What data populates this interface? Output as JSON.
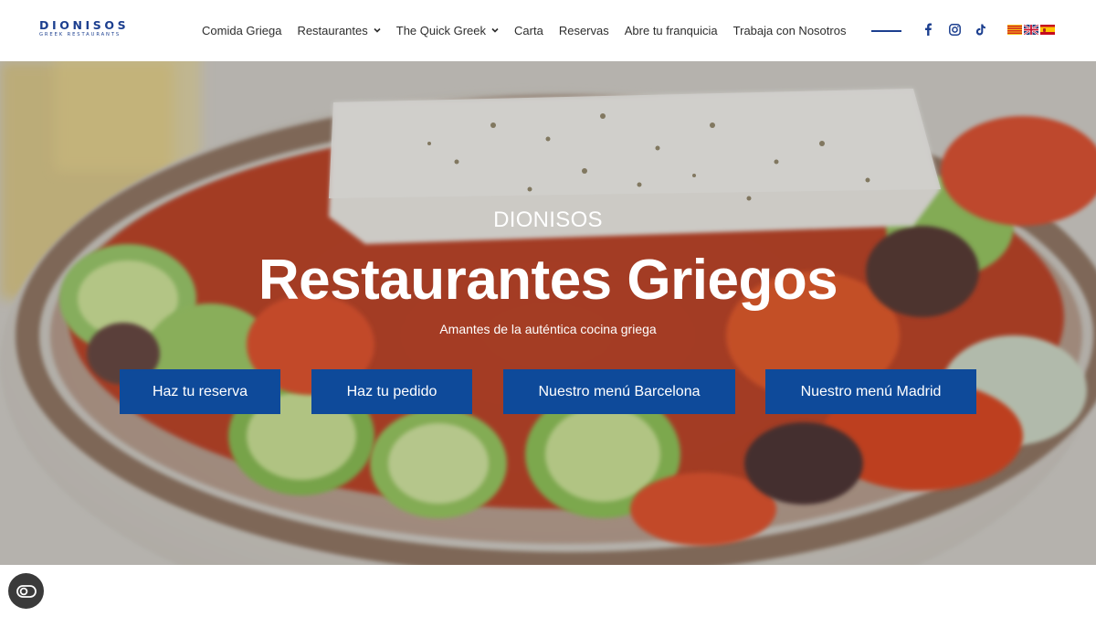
{
  "brand": {
    "name": "DIONISOS",
    "tagline": "GREEK RESTAURANTS",
    "color": "#1c3f8f"
  },
  "nav": {
    "items": [
      {
        "label": "Comida Griega",
        "has_dropdown": false
      },
      {
        "label": "Restaurantes",
        "has_dropdown": true
      },
      {
        "label": "The Quick Greek",
        "has_dropdown": true
      },
      {
        "label": "Carta",
        "has_dropdown": false
      },
      {
        "label": "Reservas",
        "has_dropdown": false
      },
      {
        "label": "Abre tu franquicia",
        "has_dropdown": false
      },
      {
        "label": "Trabaja con Nosotros",
        "has_dropdown": false
      }
    ]
  },
  "social": [
    "facebook-icon",
    "instagram-icon",
    "tiktok-icon"
  ],
  "languages": [
    "catalan",
    "english",
    "spanish"
  ],
  "hero": {
    "eyebrow": "DIONISOS",
    "title": "Restaurantes Griegos",
    "subtitle": "Amantes de la auténtica cocina griega",
    "buttons": [
      {
        "label": "Haz tu reserva"
      },
      {
        "label": "Haz tu pedido"
      },
      {
        "label": "Nuestro menú Barcelona"
      },
      {
        "label": "Nuestro menú Madrid"
      }
    ],
    "button_color": "#0e4a9a"
  },
  "accessibility": {
    "icon": "accessibility-toggle-icon"
  }
}
